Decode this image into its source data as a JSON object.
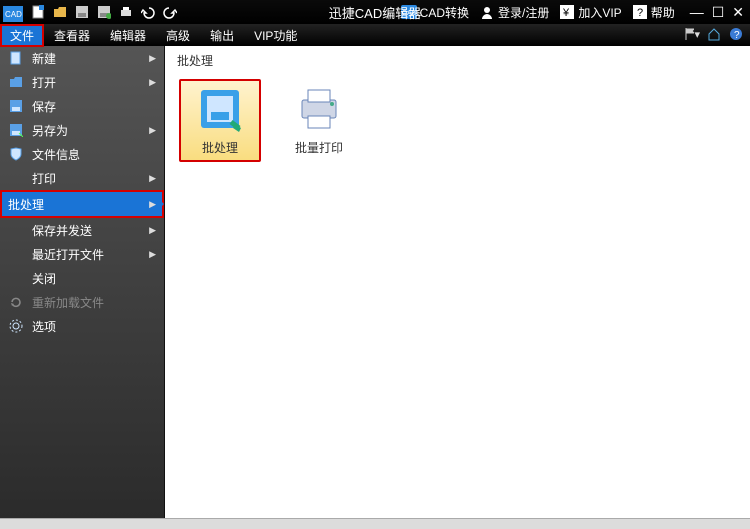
{
  "titlebar": {
    "app_title": "迅捷CAD编辑器",
    "cad_convert_label": "CAD转换",
    "login_label": "登录/注册",
    "vip_label": "加入VIP",
    "help_label": "帮助"
  },
  "menubar": {
    "items": [
      "文件",
      "查看器",
      "编辑器",
      "高级",
      "输出",
      "VIP功能"
    ],
    "active_index": 0
  },
  "sidebar": {
    "items": [
      {
        "label": "新建",
        "icon": "new-icon",
        "expandable": true
      },
      {
        "label": "打开",
        "icon": "open-icon",
        "expandable": true
      },
      {
        "label": "保存",
        "icon": "save-icon",
        "expandable": false
      },
      {
        "label": "另存为",
        "icon": "saveas-icon",
        "expandable": true
      },
      {
        "label": "文件信息",
        "icon": "fileinfo-icon",
        "expandable": false
      },
      {
        "label": "打印",
        "icon": "",
        "expandable": true
      },
      {
        "label": "批处理",
        "icon": "",
        "expandable": true,
        "selected": true
      },
      {
        "label": "保存并发送",
        "icon": "",
        "expandable": true
      },
      {
        "label": "最近打开文件",
        "icon": "",
        "expandable": true
      },
      {
        "label": "关闭",
        "icon": "",
        "expandable": false
      },
      {
        "label": "重新加载文件",
        "icon": "reload-icon",
        "expandable": false,
        "disabled": true
      },
      {
        "label": "选项",
        "icon": "options-icon",
        "expandable": false
      }
    ]
  },
  "content": {
    "section_title": "批处理",
    "tiles": [
      {
        "label": "批处理",
        "icon": "batch-icon",
        "selected": true
      },
      {
        "label": "批量打印",
        "icon": "batch-print-icon",
        "selected": false
      }
    ]
  },
  "colors": {
    "accent_blue": "#1a74d6",
    "highlight_red": "#d40000",
    "tile_selected_bg": "#f9dd80"
  }
}
